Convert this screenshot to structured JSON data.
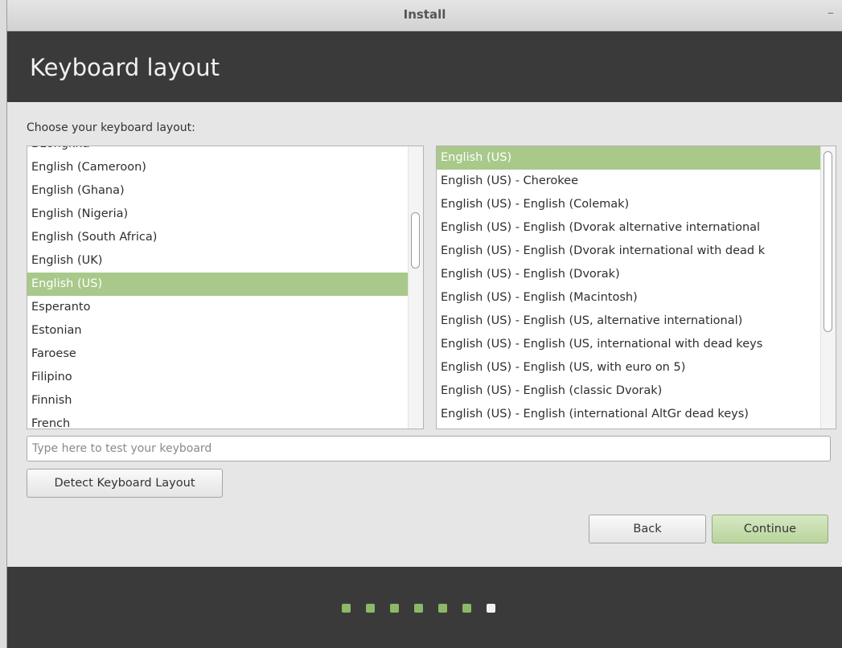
{
  "window": {
    "title": "Install"
  },
  "header": {
    "title": "Keyboard layout"
  },
  "prompt": "Choose your keyboard layout:",
  "layouts": {
    "items": [
      "Dzongkha",
      "English (Cameroon)",
      "English (Ghana)",
      "English (Nigeria)",
      "English (South Africa)",
      "English (UK)",
      "English (US)",
      "Esperanto",
      "Estonian",
      "Faroese",
      "Filipino",
      "Finnish",
      "French"
    ],
    "selected": "English (US)"
  },
  "variants": {
    "items": [
      "English (US)",
      "English (US) - Cherokee",
      "English (US) - English (Colemak)",
      "English (US) - English (Dvorak alternative international",
      "English (US) - English (Dvorak international with dead k",
      "English (US) - English (Dvorak)",
      "English (US) - English (Macintosh)",
      "English (US) - English (US, alternative international)",
      "English (US) - English (US, international with dead keys",
      "English (US) - English (US, with euro on 5)",
      "English (US) - English (classic Dvorak)",
      "English (US) - English (international AltGr dead keys)"
    ],
    "selected": "English (US)"
  },
  "test_input": {
    "placeholder": "Type here to test your keyboard",
    "value": ""
  },
  "buttons": {
    "detect": "Detect Keyboard Layout",
    "back": "Back",
    "continue": "Continue"
  },
  "progress": {
    "total_steps": 7,
    "current_step": 7
  },
  "colors": {
    "selection": "#a8c98a",
    "header_bg": "#3a3a3a",
    "progress_done": "#8db868",
    "progress_current": "#f2f2f2"
  }
}
